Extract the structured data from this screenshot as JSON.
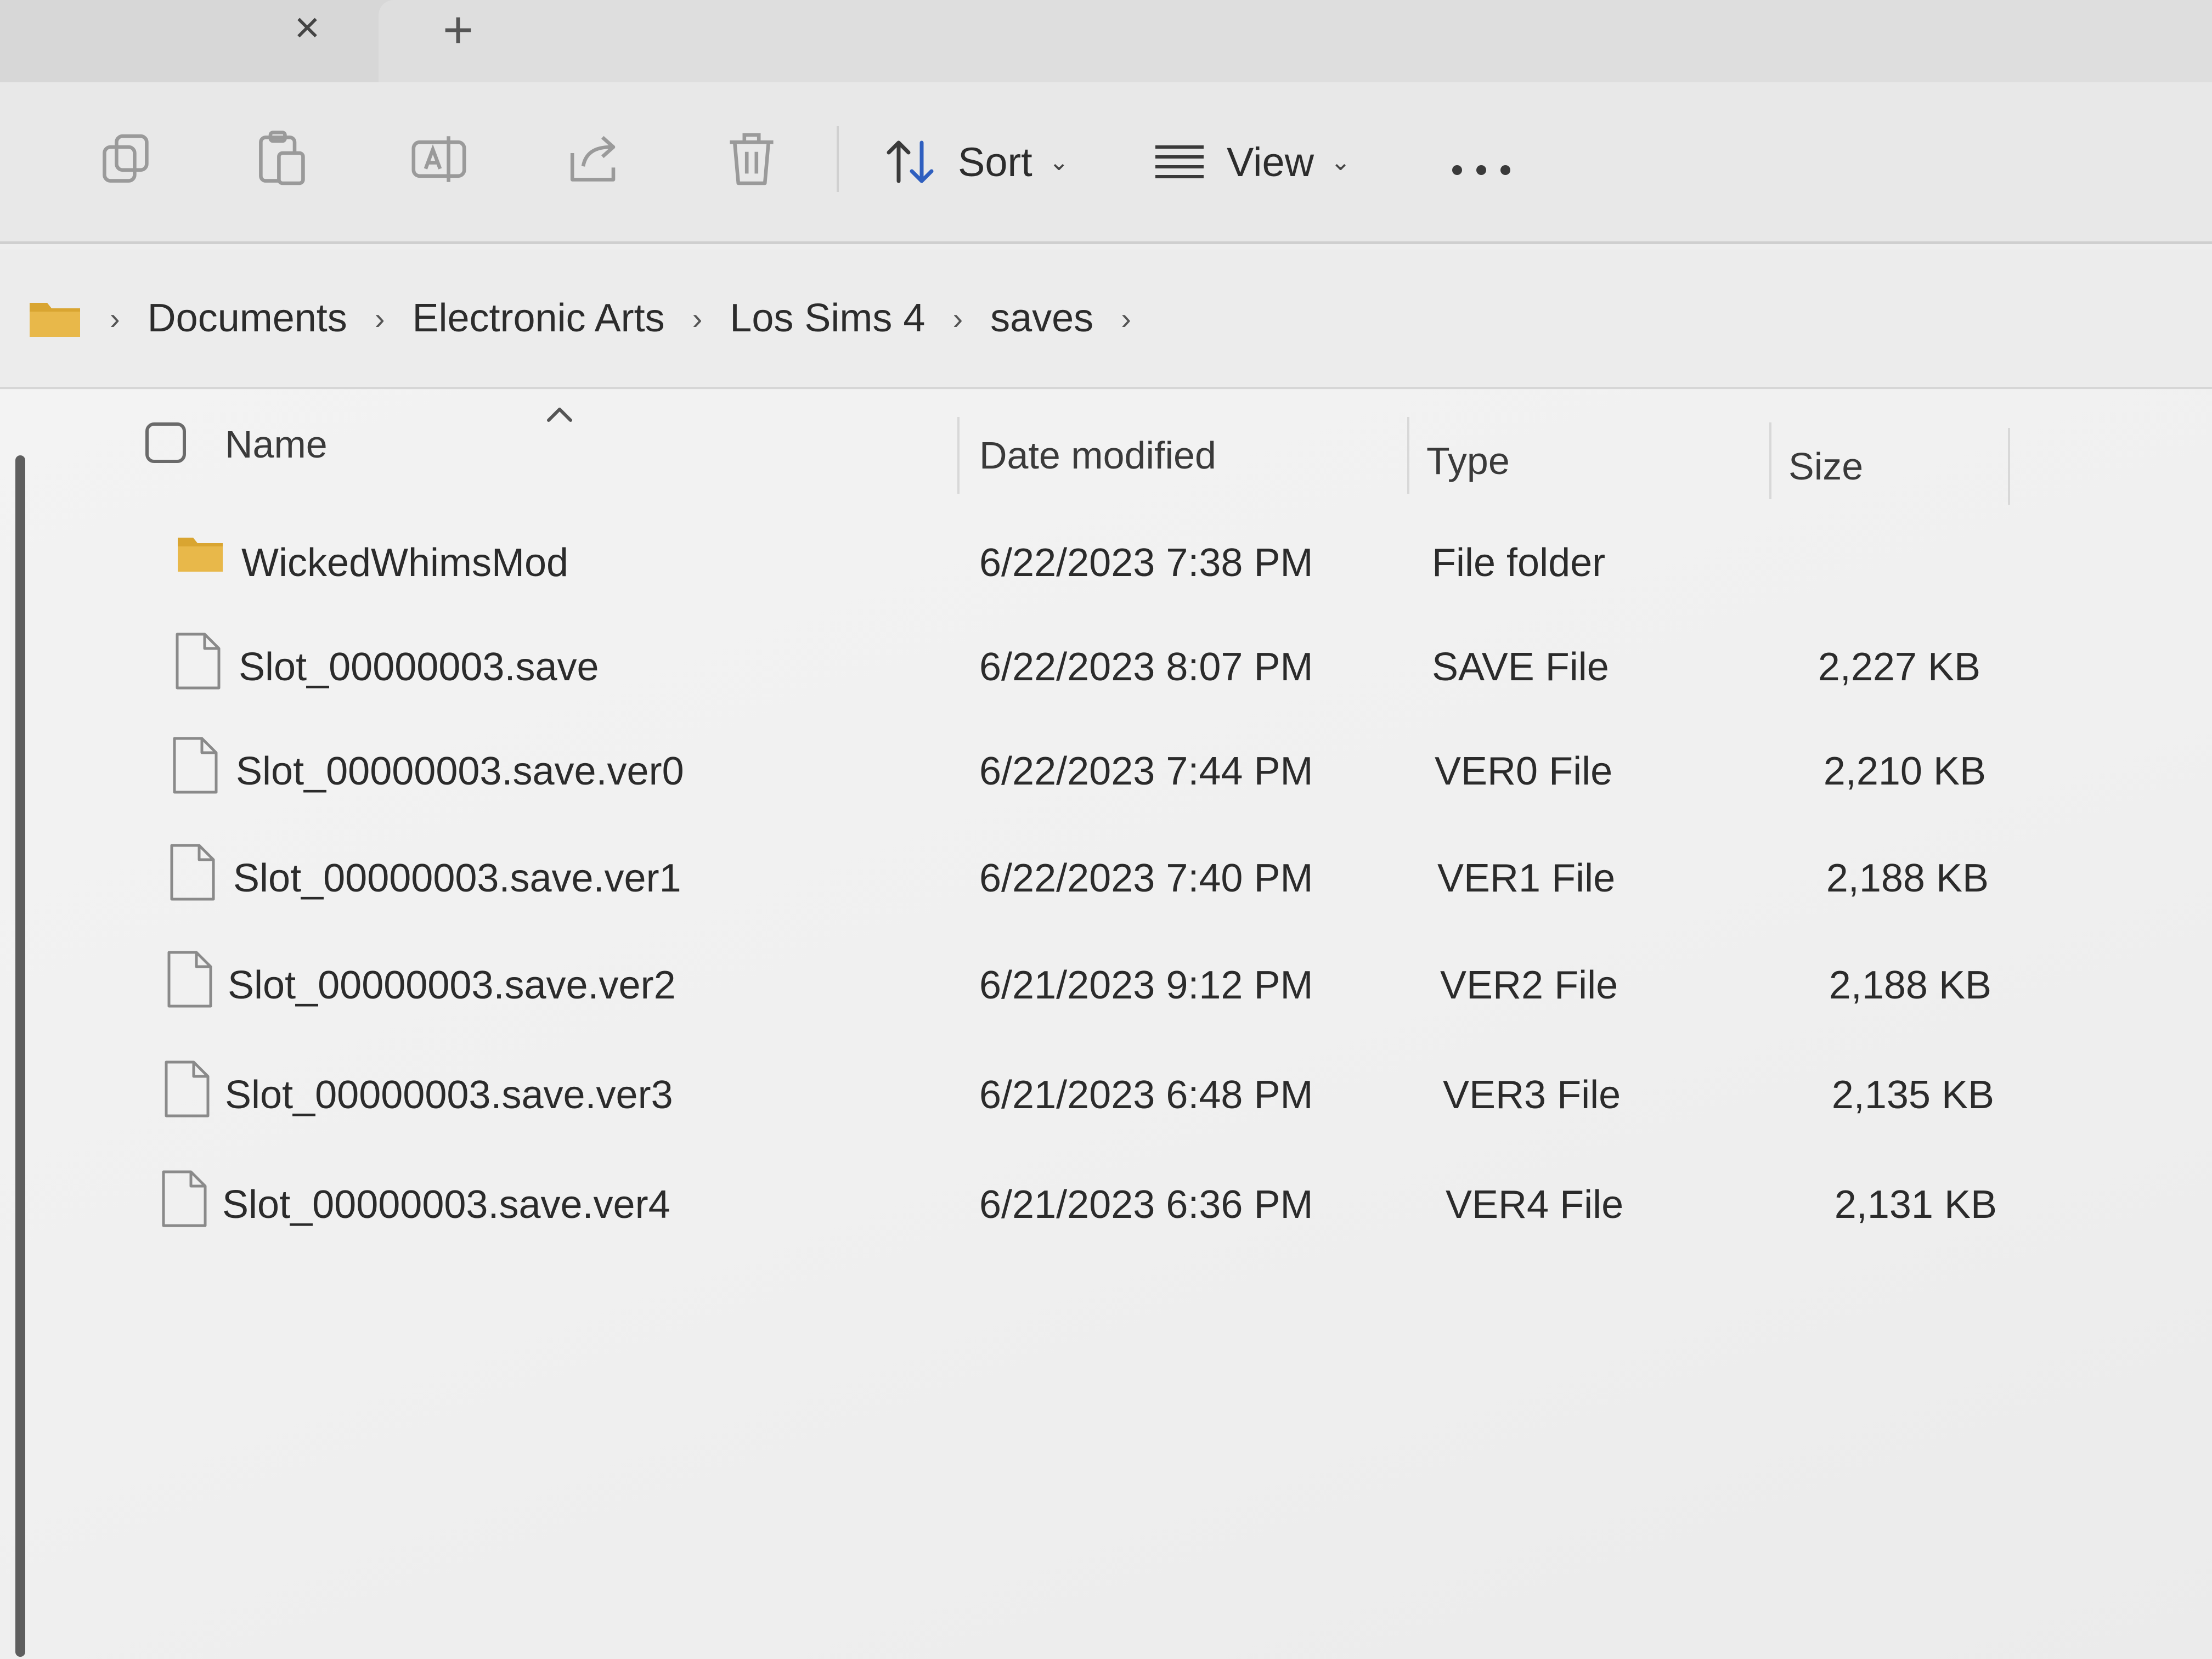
{
  "tabs": {
    "close_icon": "close-icon",
    "new_tab_icon": "plus-icon",
    "close_glyph": "×",
    "plus_glyph": "+"
  },
  "toolbar": {
    "icons": [
      "copy-icon",
      "paste-icon",
      "rename-icon",
      "share-icon",
      "delete-icon"
    ],
    "sort_label": "Sort",
    "view_label": "View",
    "chevron": "⌄",
    "more_icon": "more-icon"
  },
  "breadcrumb": {
    "root_icon": "folder-icon",
    "separator": "›",
    "items": [
      "Documents",
      "Electronic Arts",
      "Los Sims 4",
      "saves"
    ]
  },
  "columns": {
    "name": "Name",
    "date": "Date modified",
    "type": "Type",
    "size": "Size",
    "sorted_by": "Name",
    "sort_direction": "ascending"
  },
  "files": [
    {
      "icon": "folder-icon",
      "name": "WickedWhimsMod",
      "date": "6/22/2023 7:38 PM",
      "type": "File folder",
      "size": ""
    },
    {
      "icon": "file-icon",
      "name": "Slot_00000003.save",
      "date": "6/22/2023 8:07 PM",
      "type": "SAVE File",
      "size": "2,227 KB"
    },
    {
      "icon": "file-icon",
      "name": "Slot_00000003.save.ver0",
      "date": "6/22/2023 7:44 PM",
      "type": "VER0 File",
      "size": "2,210 KB"
    },
    {
      "icon": "file-icon",
      "name": "Slot_00000003.save.ver1",
      "date": "6/22/2023 7:40 PM",
      "type": "VER1 File",
      "size": "2,188 KB"
    },
    {
      "icon": "file-icon",
      "name": "Slot_00000003.save.ver2",
      "date": "6/21/2023 9:12 PM",
      "type": "VER2 File",
      "size": "2,188 KB"
    },
    {
      "icon": "file-icon",
      "name": "Slot_00000003.save.ver3",
      "date": "6/21/2023 6:48 PM",
      "type": "VER3 File",
      "size": "2,135 KB"
    },
    {
      "icon": "file-icon",
      "name": "Slot_00000003.save.ver4",
      "date": "6/21/2023 6:36 PM",
      "type": "VER4 File",
      "size": "2,131 KB"
    }
  ],
  "colors": {
    "folder": "#d9a531",
    "text": "#2b2b2b",
    "icon_stroke": "#8a8a8a"
  }
}
